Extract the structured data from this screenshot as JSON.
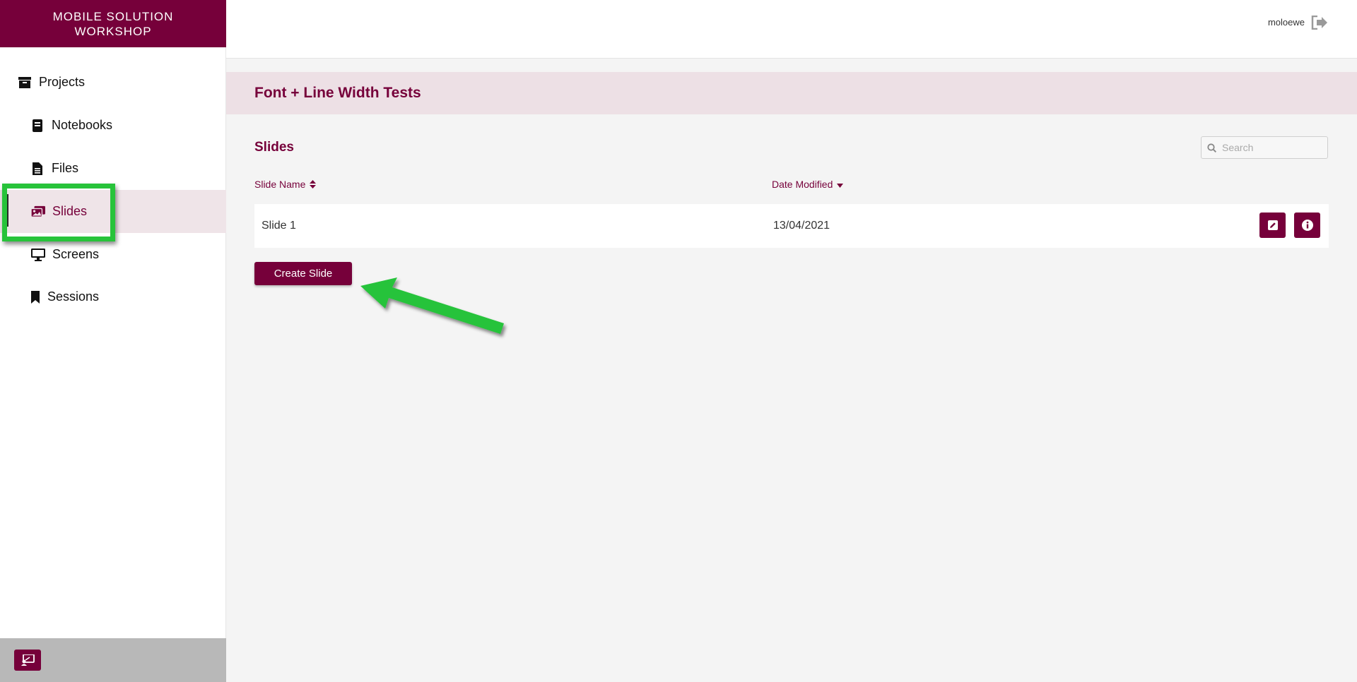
{
  "brand": {
    "line1": "MOBILE SOLUTION",
    "line2": "WORKSHOP"
  },
  "sidebar": {
    "items": [
      {
        "label": "Projects",
        "icon": "archive-icon"
      },
      {
        "label": "Notebooks",
        "icon": "book-icon"
      },
      {
        "label": "Files",
        "icon": "file-icon"
      },
      {
        "label": "Slides",
        "icon": "images-icon",
        "active": true
      },
      {
        "label": "Screens",
        "icon": "monitor-icon"
      },
      {
        "label": "Sessions",
        "icon": "bookmark-icon"
      }
    ]
  },
  "topbar": {
    "username": "moloewe",
    "logout_icon": "sign-out-icon"
  },
  "project": {
    "title": "Font + Line Width Tests"
  },
  "slides": {
    "title": "Slides",
    "search_placeholder": "Search",
    "columns": {
      "name": "Slide Name",
      "date": "Date Modified"
    },
    "rows": [
      {
        "name": "Slide 1",
        "date": "13/04/2021"
      }
    ],
    "create_label": "Create Slide"
  },
  "colors": {
    "brand": "#76003a",
    "highlight": "#27c33a",
    "active_bg": "#efe4e8"
  }
}
